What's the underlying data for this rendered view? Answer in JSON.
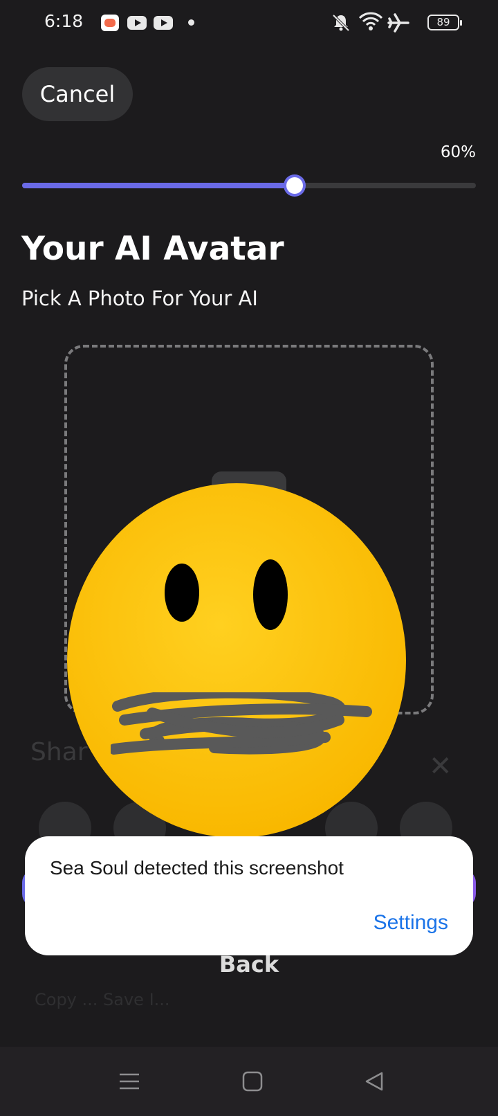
{
  "status_bar": {
    "time": "6:18",
    "battery": "89",
    "icons": [
      "game-app-icon",
      "youtube-icon",
      "youtube-icon",
      "notification-dot",
      "bell-off-icon",
      "wifi-icon",
      "airplane-icon",
      "battery-icon"
    ]
  },
  "header": {
    "cancel_label": "Cancel"
  },
  "progress": {
    "label": "60%",
    "value": 0.6
  },
  "main": {
    "title": "Your AI Avatar",
    "subtitle": "Pick A Photo For Your AI"
  },
  "background_sheet": {
    "title": "Shar",
    "footer": "Copy ... Save I..."
  },
  "footer": {
    "back_label": "Back"
  },
  "toast": {
    "message": "Sea Soul detected this screenshot",
    "action_label": "Settings"
  },
  "nav_bar": {
    "icons": [
      "menu-icon",
      "home-icon",
      "back-icon"
    ]
  },
  "colors": {
    "accent": "#6b6be8",
    "background": "#1c1b1d",
    "toast_link": "#1a73e8",
    "emoji": "#ffc400"
  }
}
